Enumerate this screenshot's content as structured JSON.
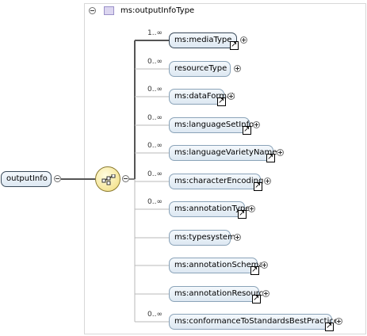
{
  "type": {
    "name": "ms:outputInfoType"
  },
  "root": {
    "label": "outputInfo"
  },
  "children": [
    {
      "label": "ms:mediaType",
      "cardinality": "1..∞",
      "ref": true
    },
    {
      "label": "resourceType",
      "cardinality": "0..∞",
      "ref": false
    },
    {
      "label": "ms:dataFormat",
      "cardinality": "0..∞",
      "ref": true
    },
    {
      "label": "ms:languageSetInfo",
      "cardinality": "0..∞",
      "ref": true
    },
    {
      "label": "ms:languageVarietyName",
      "cardinality": "0..∞",
      "ref": true
    },
    {
      "label": "ms:characterEncoding",
      "cardinality": "0..∞",
      "ref": true
    },
    {
      "label": "ms:annotationType",
      "cardinality": "0..∞",
      "ref": true
    },
    {
      "label": "ms:typesystem",
      "cardinality": "",
      "ref": false
    },
    {
      "label": "ms:annotationSchema",
      "cardinality": "",
      "ref": true
    },
    {
      "label": "ms:annotationResource",
      "cardinality": "",
      "ref": true
    },
    {
      "label": "ms:conformanceToStandardsBestPractices",
      "cardinality": "0..∞",
      "ref": true
    }
  ]
}
